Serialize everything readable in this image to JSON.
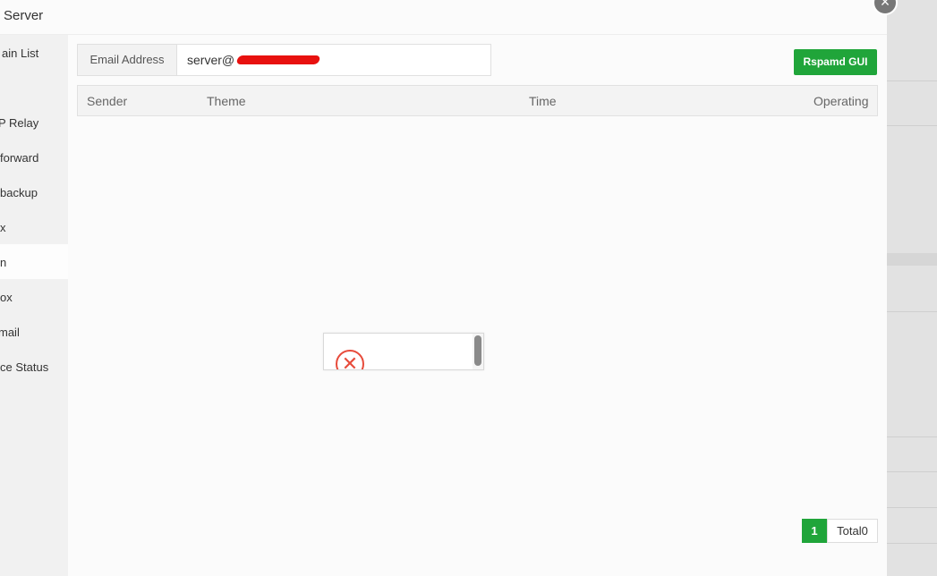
{
  "modal": {
    "title": "Server",
    "close_label": "×"
  },
  "sidebar": {
    "items": [
      {
        "label": "ain List",
        "active": false
      },
      {
        "label": "P Relay",
        "active": false
      },
      {
        "label": "forward",
        "active": false
      },
      {
        "label": "backup",
        "active": false
      },
      {
        "label": "x",
        "active": false
      },
      {
        "label": "n",
        "active": true
      },
      {
        "label": "ox",
        "active": false
      },
      {
        "label": " mail",
        "active": false
      },
      {
        "label": "ce Status",
        "active": false
      }
    ]
  },
  "search": {
    "label": "Email Address",
    "value": "server@"
  },
  "toolbar": {
    "rspamd_label": "Rspamd GUI"
  },
  "table": {
    "columns": [
      "Sender",
      "Theme",
      "Time",
      "Operating"
    ],
    "rows": []
  },
  "loading": {
    "icon": "error-icon",
    "glyph": "✕"
  },
  "pagination": {
    "current_page": "1",
    "total_label": "Total0"
  },
  "colors": {
    "accent": "#20a53a",
    "error": "#e74c3c",
    "redaction": "#e8110f"
  }
}
